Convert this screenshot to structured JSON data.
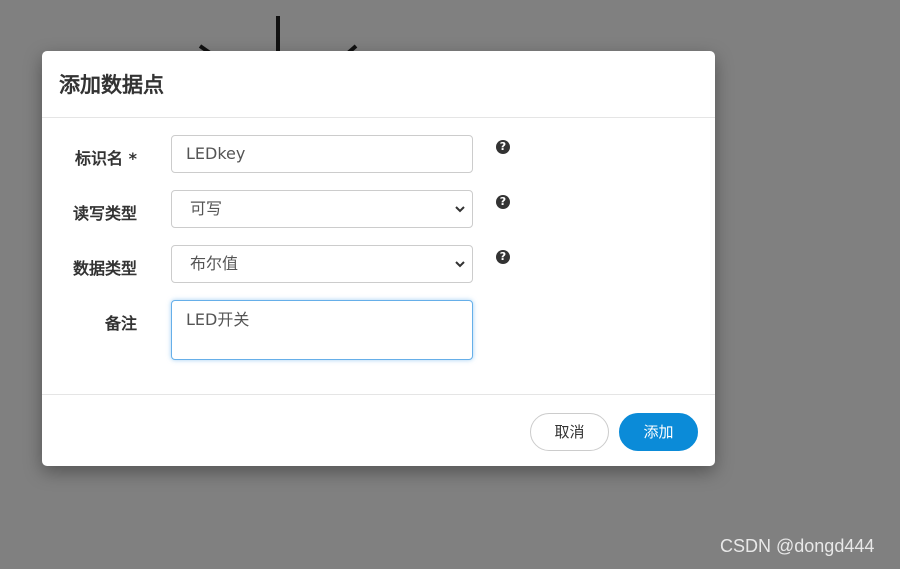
{
  "dialog": {
    "title": "添加数据点"
  },
  "form": {
    "identifier": {
      "label": "标识名 *",
      "value": "LEDkey"
    },
    "rw_type": {
      "label": "读写类型",
      "value": "可写"
    },
    "data_type": {
      "label": "数据类型",
      "value": "布尔值"
    },
    "note": {
      "label": "备注",
      "value": "LED开关"
    },
    "help_icon_glyph": "?"
  },
  "footer": {
    "cancel_label": "取消",
    "add_label": "添加"
  },
  "watermark": "CSDN @dongd444",
  "colors": {
    "primary": "#0b8bd8",
    "backdrop": "#808080",
    "focus_border": "#66afe9"
  }
}
